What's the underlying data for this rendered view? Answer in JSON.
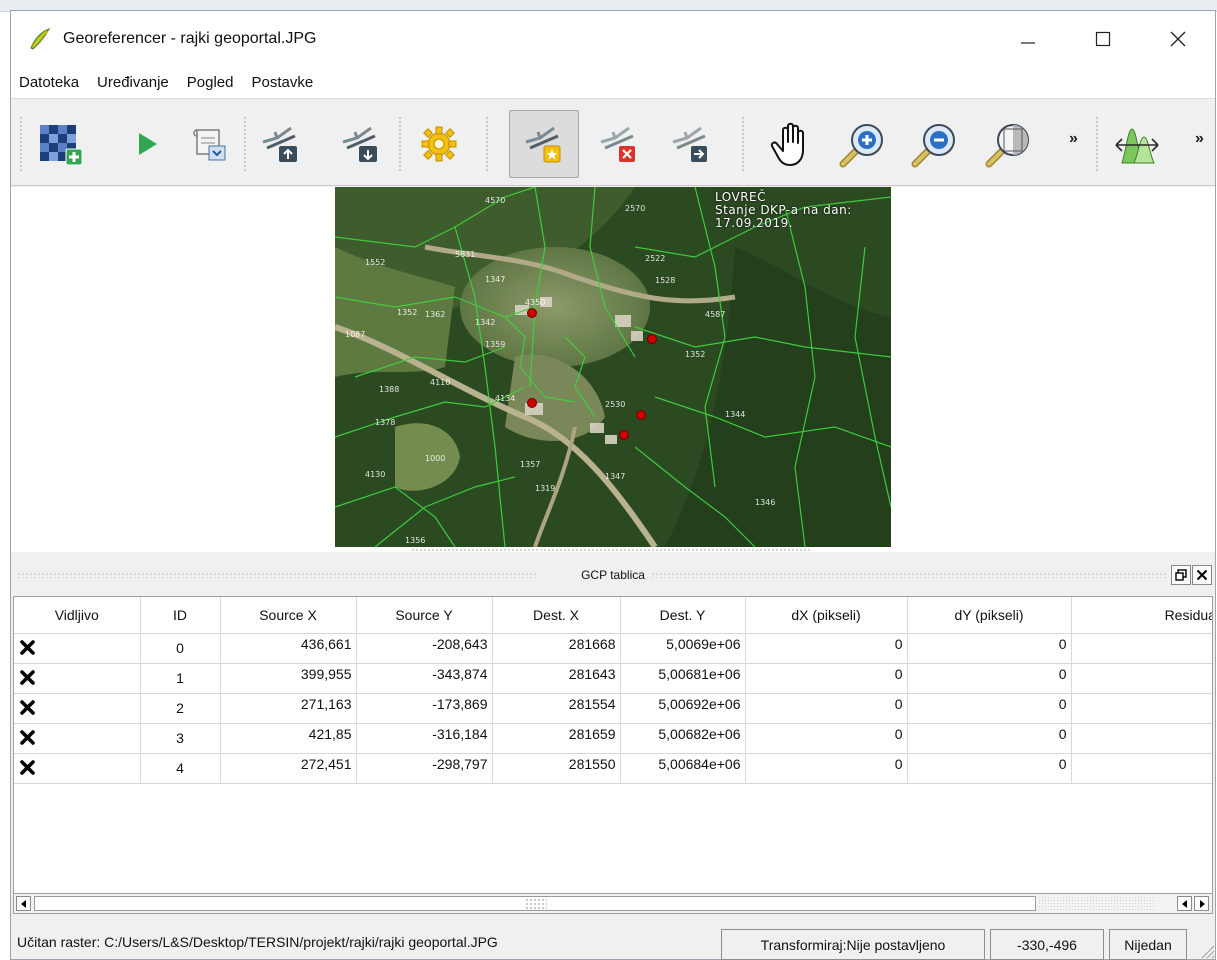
{
  "window": {
    "title": "Georeferencer - rajki geoportal.JPG",
    "minimize_glyph": "—",
    "maximize_glyph": "☐",
    "close_glyph": "✕"
  },
  "menu": [
    "Datoteka",
    "Uređivanje",
    "Pogled",
    "Postavke"
  ],
  "toolbar": {
    "icons": [
      "open-raster-icon",
      "start-georeferencing-icon",
      "generate-gdal-script-icon",
      "load-gcp-points-icon",
      "save-gcp-points-icon",
      "transformation-settings-icon",
      "add-point-icon",
      "delete-point-icon",
      "move-gcp-point-icon",
      "pan-icon",
      "zoom-in-icon",
      "zoom-out-icon",
      "zoom-to-layer-icon",
      "histogram-stretch-icon"
    ],
    "overflow_glyph": "»"
  },
  "map": {
    "label_lines": [
      "LOVREČ",
      "Stanje DKP-a na dan:",
      "17.09.2019."
    ],
    "gcp_marker_color": "#cc0000",
    "vector_color": "#3fd13f"
  },
  "gcp_panel": {
    "title": "GCP tablica",
    "float_glyph": "🗗",
    "close_glyph": "✕",
    "columns": [
      "Vidljivo",
      "ID",
      "Source X",
      "Source Y",
      "Dest. X",
      "Dest. Y",
      "dX (pikseli)",
      "dY (pikseli)",
      "Residual (pik"
    ],
    "rows": [
      {
        "visible": "✖",
        "id": "0",
        "source_x": "436,661",
        "source_y": "-208,643",
        "dest_x": "281668",
        "dest_y": "5,0069e+06",
        "dx": "0",
        "dy": "0",
        "residual": ""
      },
      {
        "visible": "✖",
        "id": "1",
        "source_x": "399,955",
        "source_y": "-343,874",
        "dest_x": "281643",
        "dest_y": "5,00681e+06",
        "dx": "0",
        "dy": "0",
        "residual": ""
      },
      {
        "visible": "✖",
        "id": "2",
        "source_x": "271,163",
        "source_y": "-173,869",
        "dest_x": "281554",
        "dest_y": "5,00692e+06",
        "dx": "0",
        "dy": "0",
        "residual": ""
      },
      {
        "visible": "✖",
        "id": "3",
        "source_x": "421,85",
        "source_y": "-316,184",
        "dest_x": "281659",
        "dest_y": "5,00682e+06",
        "dx": "0",
        "dy": "0",
        "residual": ""
      },
      {
        "visible": "✖",
        "id": "4",
        "source_x": "272,451",
        "source_y": "-298,797",
        "dest_x": "281550",
        "dest_y": "5,00684e+06",
        "dx": "0",
        "dy": "0",
        "residual": ""
      }
    ]
  },
  "scrollbar": {
    "left_glyph": "◀",
    "right_glyph": "▶"
  },
  "status": {
    "raster_text": "Učitan raster: C:/Users/L&S/Desktop/TERSIN/projekt/rajki/rajki geoportal.JPG",
    "transform_text": "Transformiraj:Nije postavljeno",
    "coords_text": "-330,-496",
    "crs_text": "Nijedan"
  },
  "colors": {
    "toolbar_blue": "#1f5aa6",
    "play_green": "#2fa84f",
    "gear_yellow": "#f2c010",
    "delete_red": "#d8342c"
  }
}
